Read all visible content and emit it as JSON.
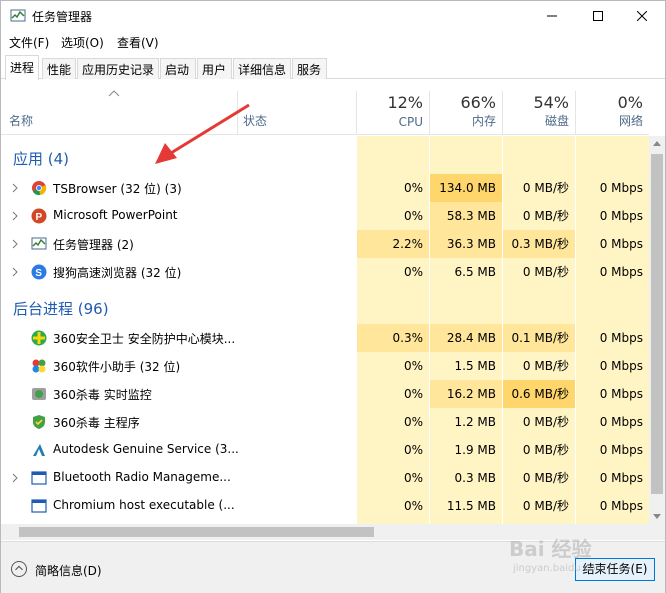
{
  "window": {
    "title": "任务管理器"
  },
  "menu": [
    "文件(F)",
    "选项(O)",
    "查看(V)"
  ],
  "tabs": [
    "进程",
    "性能",
    "应用历史记录",
    "启动",
    "用户",
    "详细信息",
    "服务"
  ],
  "columns": {
    "name": "名称",
    "status": "状态",
    "cpu": {
      "label": "CPU",
      "pct": "12%"
    },
    "memory": {
      "label": "内存",
      "pct": "66%"
    },
    "disk": {
      "label": "磁盘",
      "pct": "54%"
    },
    "network": {
      "label": "网络",
      "pct": "0%"
    }
  },
  "groups": {
    "apps": "应用 (4)",
    "background": "后台进程 (96)"
  },
  "apps": [
    {
      "name": "TSBrowser (32 位) (3)",
      "cpu": "0%",
      "mem": "134.0 MB",
      "disk": "0 MB/秒",
      "net": "0 Mbps",
      "icon": "chrome-icon"
    },
    {
      "name": "Microsoft PowerPoint",
      "cpu": "0%",
      "mem": "58.3 MB",
      "disk": "0 MB/秒",
      "net": "0 Mbps",
      "icon": "powerpoint-icon"
    },
    {
      "name": "任务管理器 (2)",
      "cpu": "2.2%",
      "mem": "36.3 MB",
      "disk": "0.3 MB/秒",
      "net": "0 Mbps",
      "icon": "task-manager-icon"
    },
    {
      "name": "搜狗高速浏览器 (32 位)",
      "cpu": "0%",
      "mem": "6.5 MB",
      "disk": "0 MB/秒",
      "net": "0 Mbps",
      "icon": "sogou-browser-icon"
    }
  ],
  "background": [
    {
      "name": "360安全卫士 安全防护中心模块...",
      "cpu": "0.3%",
      "mem": "28.4 MB",
      "disk": "0.1 MB/秒",
      "net": "0 Mbps",
      "icon": "360-guard-icon"
    },
    {
      "name": "360软件小助手 (32 位)",
      "cpu": "0%",
      "mem": "1.5 MB",
      "disk": "0 MB/秒",
      "net": "0 Mbps",
      "icon": "360-helper-icon"
    },
    {
      "name": "360杀毒 实时监控",
      "cpu": "0%",
      "mem": "16.2 MB",
      "disk": "0.6 MB/秒",
      "net": "0 Mbps",
      "icon": "360-monitor-icon"
    },
    {
      "name": "360杀毒 主程序",
      "cpu": "0%",
      "mem": "1.2 MB",
      "disk": "0 MB/秒",
      "net": "0 Mbps",
      "icon": "360-antivirus-icon"
    },
    {
      "name": "Autodesk Genuine Service (3...",
      "cpu": "0%",
      "mem": "1.9 MB",
      "disk": "0 MB/秒",
      "net": "0 Mbps",
      "icon": "autodesk-icon"
    },
    {
      "name": "Bluetooth Radio Manageme...",
      "cpu": "0%",
      "mem": "0.3 MB",
      "disk": "0 MB/秒",
      "net": "0 Mbps",
      "icon": "window-app-icon"
    },
    {
      "name": "Chromium host executable (...",
      "cpu": "0%",
      "mem": "11.5 MB",
      "disk": "0 MB/秒",
      "net": "0 Mbps",
      "icon": "window-app-icon"
    }
  ],
  "footer": {
    "brief": "简略信息(D)",
    "end_task": "结束任务(E)"
  },
  "watermark": {
    "line1": "Bai 经验",
    "line2": "jingyan.baidu.com"
  },
  "colors": {
    "group_title": "#1f5cb1",
    "highlight_light": "#fff4c4",
    "highlight_mid": "#ffe69a",
    "highlight_strong": "#ffd66b",
    "arrow": "#e53935"
  }
}
